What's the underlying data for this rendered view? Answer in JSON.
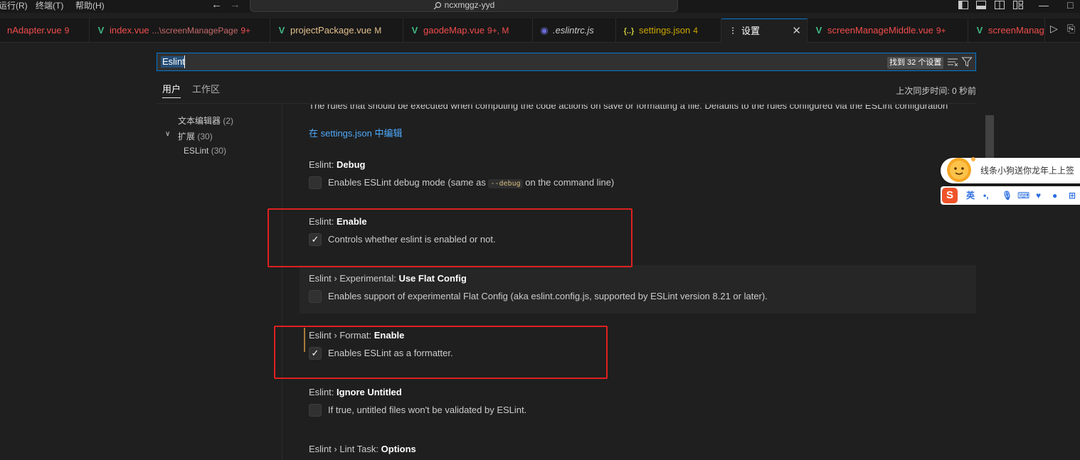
{
  "menubar": {
    "run": "运行(R)",
    "terminal": "终端(T)",
    "help": "帮助(H)"
  },
  "titlebar": {
    "search_text": "ncxmggz-yyd"
  },
  "tabs": [
    {
      "label": "nAdapter.vue",
      "badge": "9",
      "color": "#f14c4c"
    },
    {
      "label": "index.vue",
      "desc": "...\\screenManagePage",
      "badge": "9+",
      "color": "#f14c4c"
    },
    {
      "label": "projectPackage.vue",
      "badge": "M",
      "color": "#e2c08d"
    },
    {
      "label": "gaodeMap.vue",
      "badge": "9+, M",
      "color": "#f14c4c"
    },
    {
      "label": ".eslintrc.js",
      "color": "#cccccc"
    },
    {
      "label": "settings.json",
      "badge": "4",
      "color": "#cca700"
    },
    {
      "label": "设置",
      "color": "#ffffff"
    },
    {
      "label": "screenManageMiddle.vue",
      "badge": "9+",
      "color": "#f14c4c"
    },
    {
      "label": "screenManag",
      "color": "#f14c4c"
    }
  ],
  "search": {
    "value": "Eslint",
    "found": "找到 32 个设置"
  },
  "scope": {
    "user": "用户",
    "workspace": "工作区",
    "sync": "上次同步时间: 0 秒前"
  },
  "toc": [
    {
      "label": "文本编辑器",
      "count": "(2)"
    },
    {
      "label": "扩展",
      "count": "(30)"
    },
    {
      "label": "ESLint",
      "count": "(30)"
    }
  ],
  "body": {
    "cut_text": "The rules that should be executed when computing the code actions on save or formatting a file. Defaults to the rules configured via the ESLint configuration",
    "link": "在 settings.json 中编辑"
  },
  "settings": [
    {
      "prefix": "Eslint: ",
      "name": "Debug",
      "checked": false,
      "desc_pre": "Enables ESLint debug mode (same as ",
      "code": "--debug",
      "desc_post": " on the command line)"
    },
    {
      "prefix": "Eslint: ",
      "name": "Enable",
      "checked": true,
      "desc_pre": "Controls whether eslint is enabled or not."
    },
    {
      "prefix": "Eslint › Experimental: ",
      "name": "Use Flat Config",
      "checked": false,
      "desc_pre": "Enables support of experimental Flat Config (aka eslint.config.js, supported by ESLint version 8.21 or later)."
    },
    {
      "prefix": "Eslint › Format: ",
      "name": "Enable",
      "checked": true,
      "desc_pre": "Enables ESLint as a formatter."
    },
    {
      "prefix": "Eslint: ",
      "name": "Ignore Untitled",
      "checked": false,
      "desc_pre": "If true, untitled files won't be validated by ESLint."
    },
    {
      "prefix": "Eslint › Lint Task: ",
      "name": "Options"
    }
  ],
  "ime": {
    "popup": "线条小狗送你龙年上上签",
    "lang": "英"
  },
  "colors": {
    "accent": "#0078d4",
    "highlight_box": "#e02020",
    "link": "#4daafc"
  }
}
